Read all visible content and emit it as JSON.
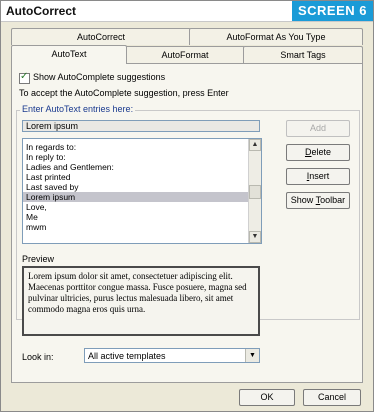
{
  "window": {
    "title": "AutoCorrect",
    "badge": "SCREEN 6"
  },
  "tabs_row1": [
    {
      "label": "AutoCorrect"
    },
    {
      "label": "AutoFormat As You Type"
    }
  ],
  "tabs_row2": [
    {
      "label": "AutoText",
      "active": true
    },
    {
      "label": "AutoFormat"
    },
    {
      "label": "Smart Tags"
    }
  ],
  "autotext": {
    "show_suggestions_label": "Show AutoComplete suggestions",
    "show_suggestions_checked": true,
    "instruction": "To accept the AutoComplete suggestion, press Enter",
    "entries_label": "Enter AutoText entries here:",
    "entry_value": "Lorem ipsum",
    "entries": [
      "In regards to:",
      "In reply to:",
      "Ladies and Gentlemen:",
      "Last printed",
      "Last saved by",
      "Lorem ipsum",
      "Love,",
      "Me",
      "mwm"
    ],
    "selected_index": 5,
    "buttons": {
      "add": "Add",
      "delete": "Delete",
      "insert": "Insert",
      "show_toolbar": "Show Toolbar"
    },
    "preview_label": "Preview",
    "preview_text": "Lorem ipsum dolor sit amet, consectetuer adipiscing elit. Maecenas porttitor congue massa. Fusce posuere, magna sed pulvinar ultricies, purus lectus malesuada libero, sit amet commodo magna eros quis urna.",
    "look_in_label": "Look in:",
    "look_in_value": "All active templates"
  },
  "footer": {
    "ok": "OK",
    "cancel": "Cancel"
  }
}
